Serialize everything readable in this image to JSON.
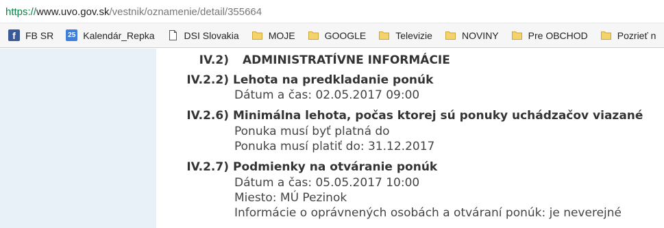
{
  "browser": {
    "url": {
      "scheme": "https://",
      "host": "www.uvo.gov.sk",
      "path": "/vestnik/oznamenie/detail/355664"
    },
    "bookmarks": [
      {
        "icon": "facebook-icon",
        "icon_text": "f",
        "label": "FB SR"
      },
      {
        "icon": "calendar-icon",
        "icon_text": "25",
        "label": "Kalendár_Repka"
      },
      {
        "icon": "page-icon",
        "label": "DSI Slovakia"
      },
      {
        "icon": "folder-icon",
        "label": "MOJE"
      },
      {
        "icon": "folder-icon",
        "label": "GOOGLE"
      },
      {
        "icon": "folder-icon",
        "label": "Televizie"
      },
      {
        "icon": "folder-icon",
        "label": "NOVINY"
      },
      {
        "icon": "folder-icon",
        "label": "Pre OBCHOD"
      },
      {
        "icon": "folder-icon",
        "label": "Pozrieť n"
      }
    ]
  },
  "colors": {
    "sidebar": "#e8f0f8",
    "folder": "#f5d36b",
    "url_scheme": "#0b8043"
  },
  "section": {
    "number": "IV.2)",
    "title": "ADMINISTRATÍVNE INFORMÁCIE",
    "items": [
      {
        "number": "IV.2.2)",
        "title": "Lehota na predkladanie ponúk",
        "lines": [
          "Dátum a čas: 02.05.2017 09:00"
        ]
      },
      {
        "number": "IV.2.6)",
        "title": "Minimálna lehota, počas ktorej sú ponuky uchádzačov viazané",
        "lines": [
          "Ponuka musí byť platná do",
          "Ponuka musí platiť do: 31.12.2017"
        ]
      },
      {
        "number": "IV.2.7)",
        "title": "Podmienky na otváranie ponúk",
        "lines": [
          "Dátum a čas: 05.05.2017 10:00",
          "Miesto: MÚ Pezinok",
          "Informácie o oprávnených osobách a otváraní ponúk: je neverejné"
        ]
      }
    ]
  }
}
